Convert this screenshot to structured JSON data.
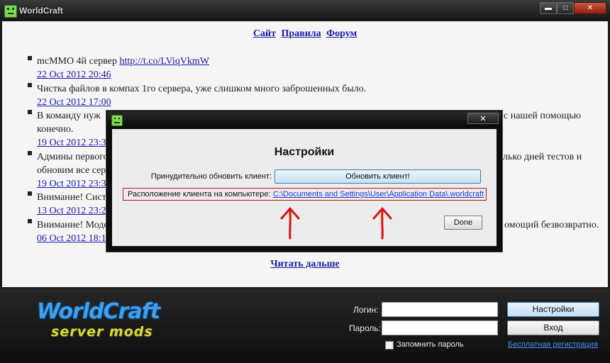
{
  "window": {
    "title": "WorldCraft",
    "minimize_glyph": "▬",
    "maximize_glyph": "□",
    "close_glyph": "✕"
  },
  "nav": {
    "links": [
      "Сайт",
      "Правила",
      "Форум"
    ]
  },
  "news": [
    {
      "text": "mcMMO 4й сервер ",
      "link": "http://t.co/LViqVkmW",
      "date": "22 Oct 2012 20:46"
    },
    {
      "text": "Чистка файлов в компах 1го сервера, уже слишком много заброшенных было.",
      "date": "22 Oct 2012 17:00"
    },
    {
      "text_left": "В команду нуж",
      "text_right": "с нашей помощью",
      "continuation": "конечно.",
      "date": "19 Oct 2012 23:3"
    },
    {
      "text_left": "Админы первого",
      "text_right": "лько дней тестов и",
      "continuation": "обновим все сер",
      "date": "19 Oct 2012 23:3"
    },
    {
      "text": "Внимание! Систе",
      "date": "13 Oct 2012 23:2"
    },
    {
      "text_left": "Внимание! Моде",
      "text_right": "омощий безвозвратно.",
      "date": "06 Oct 2012 18:1"
    }
  ],
  "read_more": "Читать дальше",
  "logo": {
    "main": "WorldCraft",
    "sub": "server mods"
  },
  "login": {
    "login_label": "Логин:",
    "password_label": "Пароль:",
    "login_value": "",
    "password_value": "",
    "settings_button": "Настройки",
    "enter_button": "Вход",
    "remember_label": "Запомнить пароль",
    "remember_checked": false,
    "register_link": "Бесплатная регистрация"
  },
  "dialog": {
    "close_glyph": "✕",
    "title": "Настройки",
    "force_update_label": "Принудительно обновить клиент:",
    "force_update_button": "Обновить клиент!",
    "location_label": "Расположение клиента на компьютере:",
    "location_path": "C:\\Documents and Settings\\User\\Application Data\\.worldcraft",
    "done_button": "Done"
  },
  "colors": {
    "link": "#1a1aa6",
    "highlight_box": "#cc1111",
    "annotation_arrow": "#e01010",
    "logo_blue": "#3da0f0",
    "logo_yellow": "#dada2b"
  }
}
